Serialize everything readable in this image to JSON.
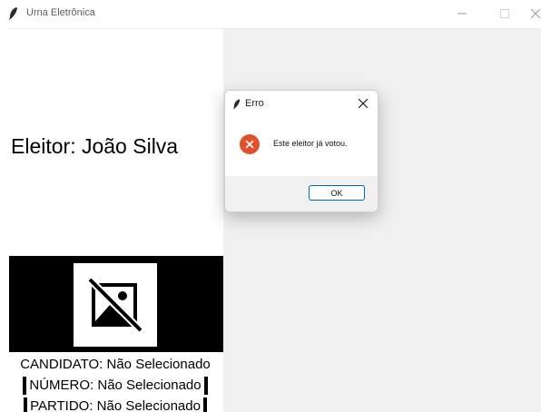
{
  "window": {
    "title": "Urna Eletrônica",
    "controls": [
      "minimize-icon",
      "maximize-icon",
      "close-icon"
    ]
  },
  "voter": {
    "label": "Eleitor: João Silva"
  },
  "candidate": {
    "photo_icon": "image-unavailable-icon",
    "name_line": "CANDIDATO: Não Selecionado",
    "number_line": "NÚMERO: Não Selecionado",
    "party_line": "PARTIDO: Não Selecionado"
  },
  "dialog": {
    "title": "Erro",
    "icon": "error-icon",
    "message": "Este eleitor já votou.",
    "ok_label": "OK",
    "colors": {
      "error": "#e2502b",
      "ok_border": "#0067c0"
    }
  }
}
